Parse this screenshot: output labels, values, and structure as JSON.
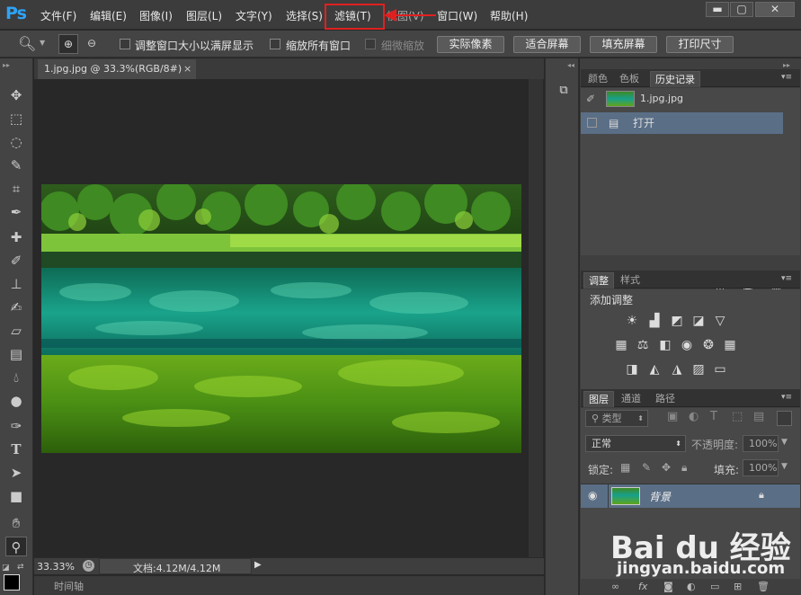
{
  "app": {
    "logo": "Ps"
  },
  "menu": {
    "items": [
      "文件(F)",
      "编辑(E)",
      "图像(I)",
      "图层(L)",
      "文字(Y)",
      "选择(S)",
      "滤镜(T)",
      "视图(V)",
      "窗口(W)",
      "帮助(H)"
    ],
    "highlighted": "滤镜(T)"
  },
  "window_controls": {
    "minimize": "▬",
    "maximize": "▢",
    "close": "✕"
  },
  "options": {
    "checkboxes": [
      "调整窗口大小以满屏显示",
      "缩放所有窗口",
      "细微缩放"
    ],
    "buttons": [
      "实际像素",
      "适合屏幕",
      "填充屏幕",
      "打印尺寸"
    ]
  },
  "document": {
    "tab_title": "1.jpg.jpg @ 33.3%(RGB/8#)",
    "tab_close": "×",
    "zoom": "33.33%",
    "doc_size": "文档:4.12M/4.12M",
    "timeline_label": "时间轴"
  },
  "history_panel": {
    "tabs": [
      "颜色",
      "色板",
      "历史记录"
    ],
    "active_tab": "历史记录",
    "snapshot_name": "1.jpg.jpg",
    "states": [
      "打开"
    ]
  },
  "adjust_panel": {
    "tabs": [
      "调整",
      "样式"
    ],
    "active_tab": "调整",
    "heading": "添加调整"
  },
  "layers_panel": {
    "tabs": [
      "图层",
      "通道",
      "路径"
    ],
    "active_tab": "图层",
    "filter_kind": "类型",
    "blend_mode": "正常",
    "opacity_label": "不透明度:",
    "opacity_value": "100%",
    "lock_label": "锁定:",
    "fill_label": "填充:",
    "fill_value": "100%",
    "layers": [
      {
        "name": "背景",
        "locked": true,
        "visible": true
      }
    ]
  },
  "watermark": {
    "brand": "Bai du 经验",
    "url": "jingyan.baidu.com"
  },
  "colors": {
    "accent_red": "#e02020",
    "selection_blue": "#5a6e86",
    "ps_blue": "#2fa3f5"
  }
}
